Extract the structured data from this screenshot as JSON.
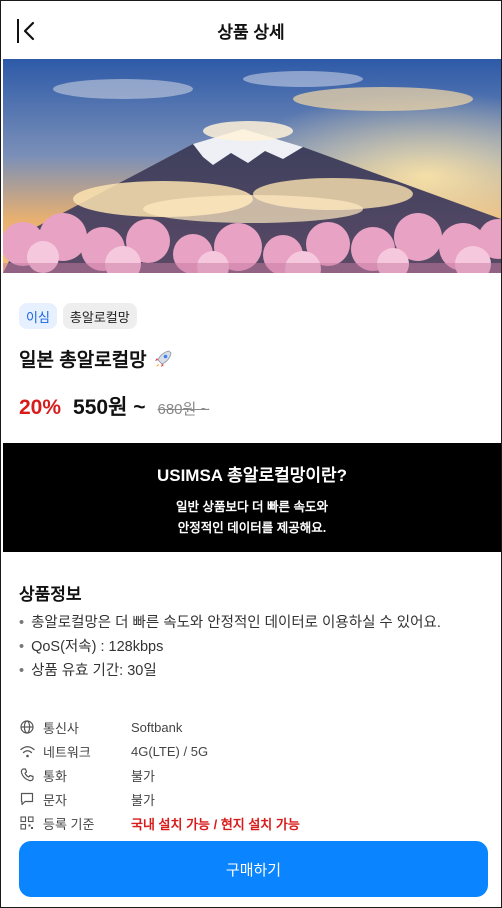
{
  "header": {
    "title": "상품 상세",
    "back_icon": "chevron-left-icon"
  },
  "product": {
    "tags": [
      "이심",
      "총알로컬망"
    ],
    "name": "일본 총알로컬망",
    "name_icon": "rocket-icon",
    "discount": "20%",
    "sale_price": "550원 ~",
    "original_price": "680원 ~"
  },
  "banner": {
    "headline": "USIMSA 총알로컬망이란?",
    "line1": "일반 상품보다 더 빠른 속도와",
    "line2": "안정적인 데이터를 제공해요."
  },
  "details": {
    "title": "상품정보",
    "bullets": [
      "총알로컬망은 더 빠른 속도와 안정적인 데이터로 이용하실 수 있어요.",
      "QoS(저속) : 128kbps",
      "상품 유효 기간: 30일"
    ],
    "specs": [
      {
        "icon": "globe-icon",
        "label": "통신사",
        "value": "Softbank"
      },
      {
        "icon": "wifi-icon",
        "label": "네트워크",
        "value": "4G(LTE) / 5G"
      },
      {
        "icon": "phone-icon",
        "label": "통화",
        "value": "불가"
      },
      {
        "icon": "message-icon",
        "label": "문자",
        "value": "불가"
      },
      {
        "icon": "qr-icon",
        "label": "등록 기준",
        "value": "국내 설치 가능 / 현지 설치 가능"
      }
    ]
  },
  "buy_button": {
    "label": "구매하기",
    "color": "#0a84ff"
  },
  "colors": {
    "discount": "#d81b1b",
    "banner_bg": "#000000",
    "tag_blue_bg": "#e6f0ff",
    "tag_blue_text": "#1a66e0"
  }
}
